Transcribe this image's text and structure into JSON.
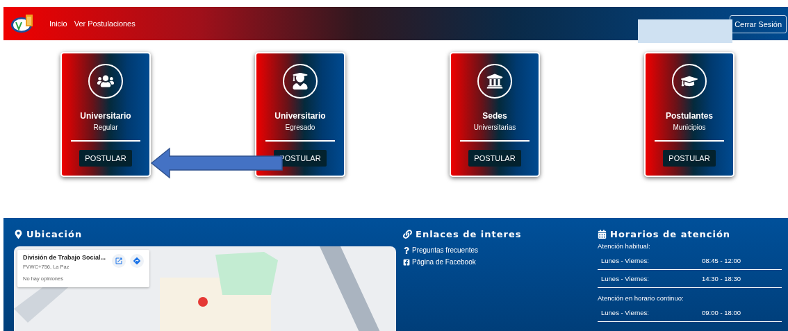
{
  "header": {
    "nav": [
      {
        "label": "Inicio"
      },
      {
        "label": "Ver Postulaciones"
      }
    ],
    "logout": "Cerrar Sesión"
  },
  "cards": [
    {
      "title": "Universitario",
      "subtitle": "Regular",
      "button": "POSTULAR"
    },
    {
      "title": "Universitario",
      "subtitle": "Egresado",
      "button": "POSTULAR"
    },
    {
      "title": "Sedes",
      "subtitle": "Universitarias",
      "button": "POSTULAR"
    },
    {
      "title": "Postulantes",
      "subtitle": "Municipios",
      "button": "POSTULAR"
    }
  ],
  "footer": {
    "location": {
      "title": "Ubicación",
      "place": {
        "name": "División de Trabajo Social...",
        "address": "FVWC+756, La Paz",
        "reviews": "No hay opiniones"
      }
    },
    "links": {
      "title": "Enlaces de interes",
      "items": [
        {
          "label": "Preguntas frecuentes"
        },
        {
          "label": "Página de Facebook"
        }
      ]
    },
    "hours": {
      "title": "Horarios de atención",
      "groups": [
        {
          "label": "Atención habitual:",
          "rows": [
            {
              "days": "Lunes - Viernes:",
              "time": "08:45 - 12:00"
            },
            {
              "days": "Lunes - Viernes:",
              "time": "14:30 - 18:30"
            }
          ]
        },
        {
          "label": "Atención en horario continuo:",
          "rows": [
            {
              "days": "Lunes - Viernes:",
              "time": "09:00 - 18:00"
            }
          ]
        }
      ]
    }
  }
}
